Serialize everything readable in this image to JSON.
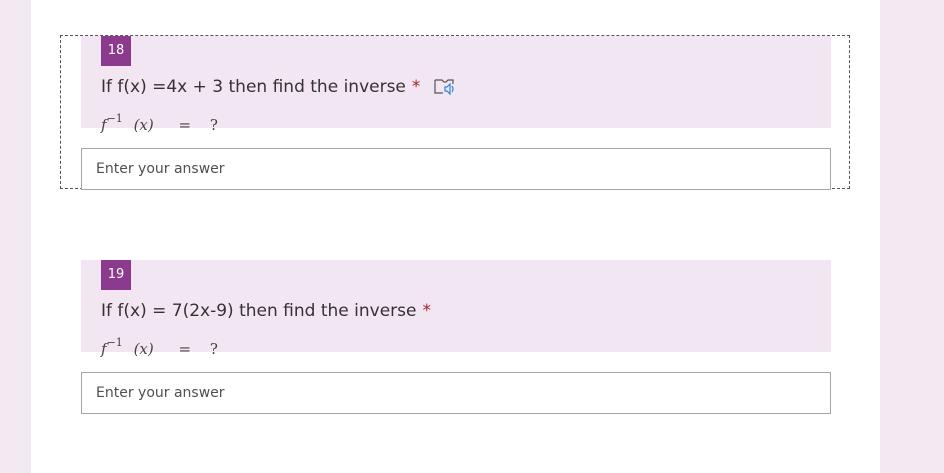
{
  "questions": [
    {
      "number": "18",
      "title": "If f(x) =4x + 3  then find the inverse",
      "required_mark": "*",
      "formula": {
        "fn": "f",
        "exp": "−1",
        "arg": "(x)",
        "eq": "=",
        "q": "?"
      },
      "answer_placeholder": "Enter your answer",
      "answer_value": "",
      "has_reader_icon": true
    },
    {
      "number": "19",
      "title": "If f(x) = 7(2x-9) then find the inverse",
      "required_mark": "*",
      "formula": {
        "fn": "f",
        "exp": "−1",
        "arg": "(x)",
        "eq": "=",
        "q": "?"
      },
      "answer_placeholder": "Enter your answer",
      "answer_value": "",
      "has_reader_icon": false
    }
  ],
  "colors": {
    "page_bg": "#f3e9f3",
    "question_bg": "#f2e6f2",
    "number_badge": "#8b3a8e",
    "required": "#a4262c"
  },
  "icons": {
    "reader": "immersive-reader-icon"
  }
}
